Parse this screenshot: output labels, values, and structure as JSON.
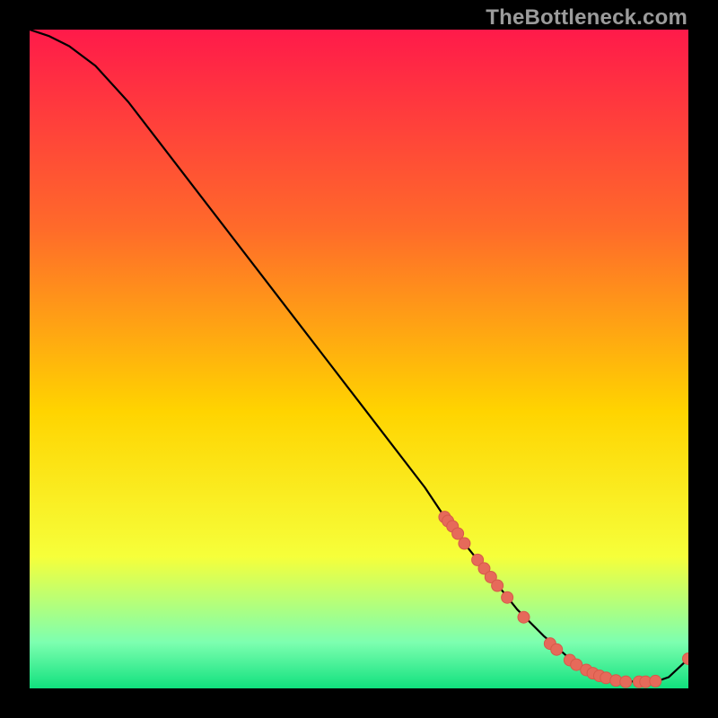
{
  "attribution": "TheBottleneck.com",
  "colors": {
    "gradient_top": "#ff1a4a",
    "gradient_mid1": "#ff6a2a",
    "gradient_mid2": "#ffd400",
    "gradient_mid3": "#f6ff3a",
    "gradient_green1": "#7dffb0",
    "gradient_green2": "#11e17e",
    "curve": "#000000",
    "dot_fill": "#e66a5a",
    "dot_stroke": "#d65a4a"
  },
  "chart_data": {
    "type": "line",
    "title": "",
    "xlabel": "",
    "ylabel": "",
    "xlim": [
      0,
      100
    ],
    "ylim": [
      0,
      100
    ],
    "series": [
      {
        "name": "bottleneck-curve",
        "x": [
          0,
          3,
          6,
          10,
          15,
          20,
          25,
          30,
          35,
          40,
          45,
          50,
          55,
          60,
          63,
          66,
          70,
          74,
          78,
          82,
          84,
          86,
          88,
          90,
          92,
          95,
          97,
          100
        ],
        "y": [
          100,
          99,
          97.5,
          94.5,
          89,
          82.5,
          76,
          69.5,
          63,
          56.5,
          50,
          43.5,
          37,
          30.5,
          26,
          22,
          17,
          12,
          8,
          4.5,
          3.3,
          2.4,
          1.7,
          1.2,
          1.0,
          1.0,
          1.7,
          4.5
        ]
      }
    ],
    "dots": [
      {
        "x": 63.0,
        "y": 26.0
      },
      {
        "x": 63.5,
        "y": 25.4
      },
      {
        "x": 64.2,
        "y": 24.6
      },
      {
        "x": 65.0,
        "y": 23.5
      },
      {
        "x": 66.0,
        "y": 22.0
      },
      {
        "x": 68.0,
        "y": 19.5
      },
      {
        "x": 69.0,
        "y": 18.2
      },
      {
        "x": 70.0,
        "y": 16.9
      },
      {
        "x": 71.0,
        "y": 15.6
      },
      {
        "x": 72.5,
        "y": 13.8
      },
      {
        "x": 75.0,
        "y": 10.8
      },
      {
        "x": 79.0,
        "y": 6.8
      },
      {
        "x": 80.0,
        "y": 5.9
      },
      {
        "x": 82.0,
        "y": 4.3
      },
      {
        "x": 83.0,
        "y": 3.6
      },
      {
        "x": 84.5,
        "y": 2.8
      },
      {
        "x": 85.5,
        "y": 2.3
      },
      {
        "x": 86.5,
        "y": 1.9
      },
      {
        "x": 87.5,
        "y": 1.6
      },
      {
        "x": 89.0,
        "y": 1.2
      },
      {
        "x": 90.5,
        "y": 1.0
      },
      {
        "x": 92.5,
        "y": 1.0
      },
      {
        "x": 93.5,
        "y": 1.0
      },
      {
        "x": 95.0,
        "y": 1.1
      },
      {
        "x": 100.0,
        "y": 4.5
      }
    ]
  }
}
